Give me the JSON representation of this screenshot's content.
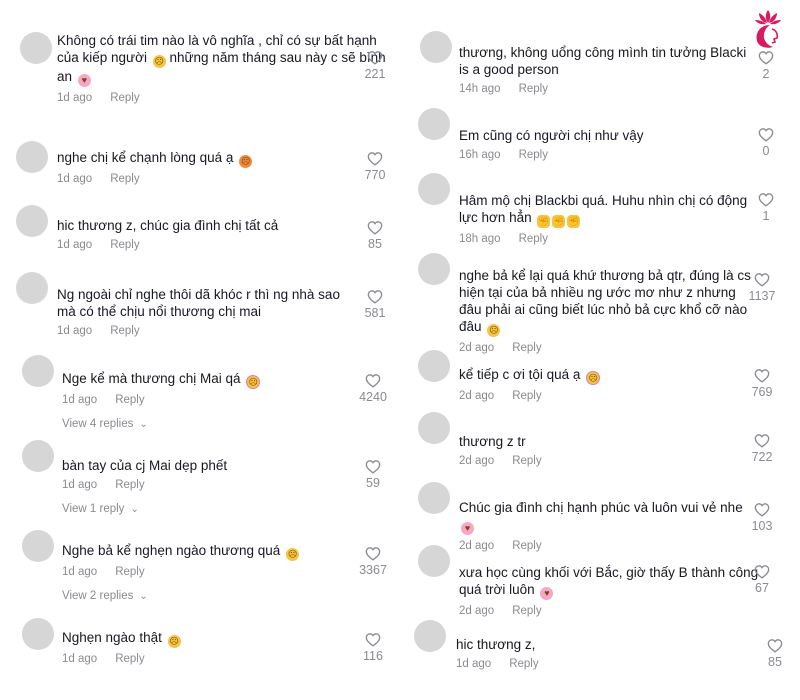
{
  "left_comments": [
    {
      "text": "Không có trái tim nào là vô nghĩa , chỉ có sự bất hạnh của kiếp người",
      "text_tail": "những năm tháng sau này c sẽ bình an",
      "emojis_mid": [
        "sad"
      ],
      "emojis_end": [
        "hearts"
      ],
      "age": "1d ago",
      "reply": "Reply",
      "likes": "221"
    },
    {
      "text": "nghe chị kể chạnh lòng quá ạ",
      "emojis_end": [
        "angry"
      ],
      "age": "1d ago",
      "reply": "Reply",
      "likes": "770"
    },
    {
      "text": "hic thương z, chúc gia đình chị tất cả",
      "age": "1d ago",
      "reply": "Reply",
      "likes": "85"
    },
    {
      "text": "Ng ngoài chỉ nghe thôi dã khóc r thì ng nhà sao mà có thể chịu nổi thương chị mai",
      "age": "1d ago",
      "reply": "Reply",
      "likes": "581"
    },
    {
      "text": "Nge kể mà thương chị Mai qá",
      "emojis_end": [
        "cry"
      ],
      "age": "1d ago",
      "reply": "Reply",
      "likes": "4240",
      "view_replies": "View 4 replies"
    },
    {
      "text": "bàn tay của cj Mai dẹp phết",
      "age": "1d ago",
      "reply": "Reply",
      "likes": "59",
      "view_replies": "View 1 reply"
    },
    {
      "text": "Nghe bả kể nghẹn ngào thương quá",
      "emojis_end": [
        "sad"
      ],
      "age": "1d ago",
      "reply": "Reply",
      "likes": "3367",
      "view_replies": "View 2 replies"
    },
    {
      "text": "Nghẹn ngào thật",
      "emojis_end": [
        "sad"
      ],
      "age": "1d ago",
      "reply": "Reply",
      "likes": "116"
    }
  ],
  "right_comments": [
    {
      "text": "thương, không uổng công mình tin tưởng Blacki is a good person",
      "age": "14h ago",
      "reply": "Reply",
      "likes": "2"
    },
    {
      "text": "Em cũng có người chị như vậy",
      "age": "16h ago",
      "reply": "Reply",
      "likes": "0"
    },
    {
      "text": "Hâm mộ chị Blackbi quá. Huhu nhìn chị có động lực hơn hẳn",
      "emojis_end": [
        "muscle",
        "muscle",
        "muscle"
      ],
      "age": "18h ago",
      "reply": "Reply",
      "likes": "1"
    },
    {
      "text": "nghe bả kể lại quá khứ thương bả qtr, đúng là cs hiện tại của bả nhiều ng ước mơ như z nhưng đâu phải ai cũng biết lúc nhỏ bả cực khổ cỡ nào đâu",
      "emojis_end": [
        "sad"
      ],
      "age": "2d ago",
      "reply": "Reply",
      "likes": "1137"
    },
    {
      "text": "kể tiếp c ơi tội quá ạ",
      "emojis_end": [
        "cry"
      ],
      "age": "2d ago",
      "reply": "Reply",
      "likes": "769"
    },
    {
      "text": "thương z tr",
      "age": "2d ago",
      "reply": "Reply",
      "likes": "722"
    },
    {
      "text": "Chúc gia đình chị hạnh phúc và luôn vui vẻ nhe",
      "emojis_end": [
        "hearts"
      ],
      "age": "2d ago",
      "reply": "Reply",
      "likes": "103"
    },
    {
      "text": "xưa học cùng khối với Bắc, giờ thấy B thành công quá trời luôn",
      "emojis_end": [
        "hearts"
      ],
      "age": "2d ago",
      "reply": "Reply",
      "likes": "67"
    },
    {
      "text": "hic thương z,",
      "age": "1d ago",
      "reply": "Reply",
      "likes": "85"
    }
  ],
  "colors": {
    "text": "#161823",
    "muted": "#8a8b91",
    "avatar": "#d6d6d6",
    "logo": "#d81b60"
  },
  "logo": {
    "icon": "lotus-woman-logo"
  }
}
